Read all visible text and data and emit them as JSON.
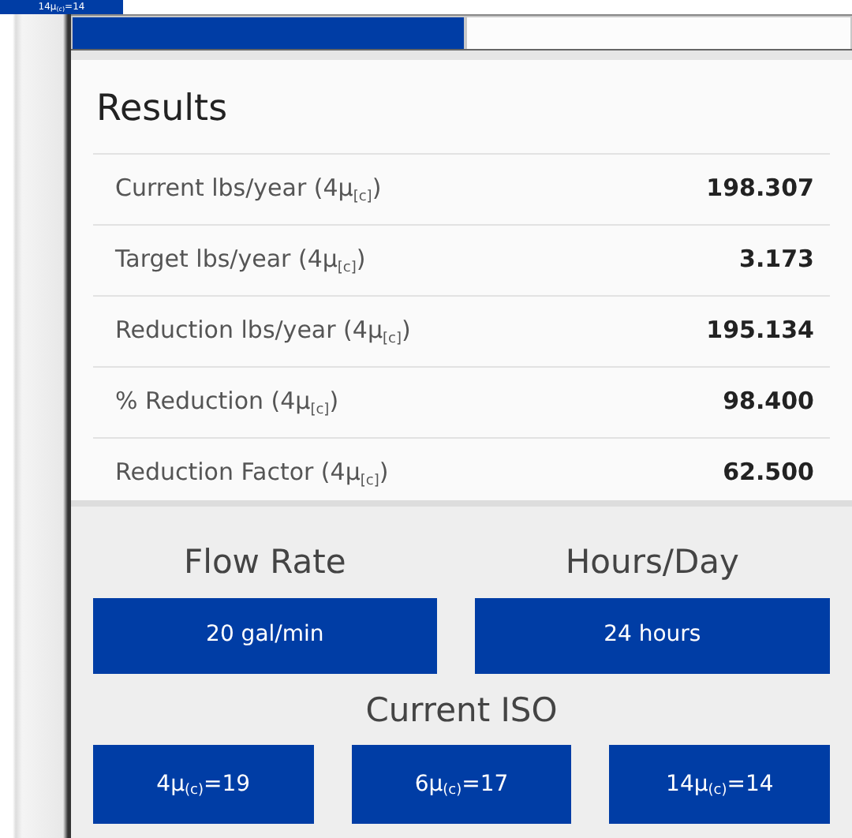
{
  "behind_button": {
    "label": "14μ$_{(c)}$=14"
  },
  "tabs": [
    {
      "selected": true
    },
    {
      "selected": false
    }
  ],
  "results": {
    "title": "Results",
    "rows": [
      {
        "label": "Current lbs/year (4μ$_{[c]}$)",
        "value": "198.307"
      },
      {
        "label": "Target lbs/year (4μ$_{[c]}$)",
        "value": "3.173"
      },
      {
        "label": "Reduction lbs/year (4μ$_{[c]}$)",
        "value": "195.134"
      },
      {
        "label": "% Reduction (4μ$_{[c]}$)",
        "value": "98.400"
      },
      {
        "label": "Reduction Factor (4μ$_{[c]}$)",
        "value": "62.500"
      }
    ]
  },
  "inputs": [
    {
      "label": "Flow Rate",
      "button": "20 gal/min"
    },
    {
      "label": "Hours/Day",
      "button": "24 hours"
    }
  ],
  "current_iso": {
    "label": "Current ISO",
    "buttons": [
      "4μ$_{(c)}$=19",
      "6μ$_{(c)}$=17",
      "14μ$_{(c)}$=14"
    ]
  }
}
